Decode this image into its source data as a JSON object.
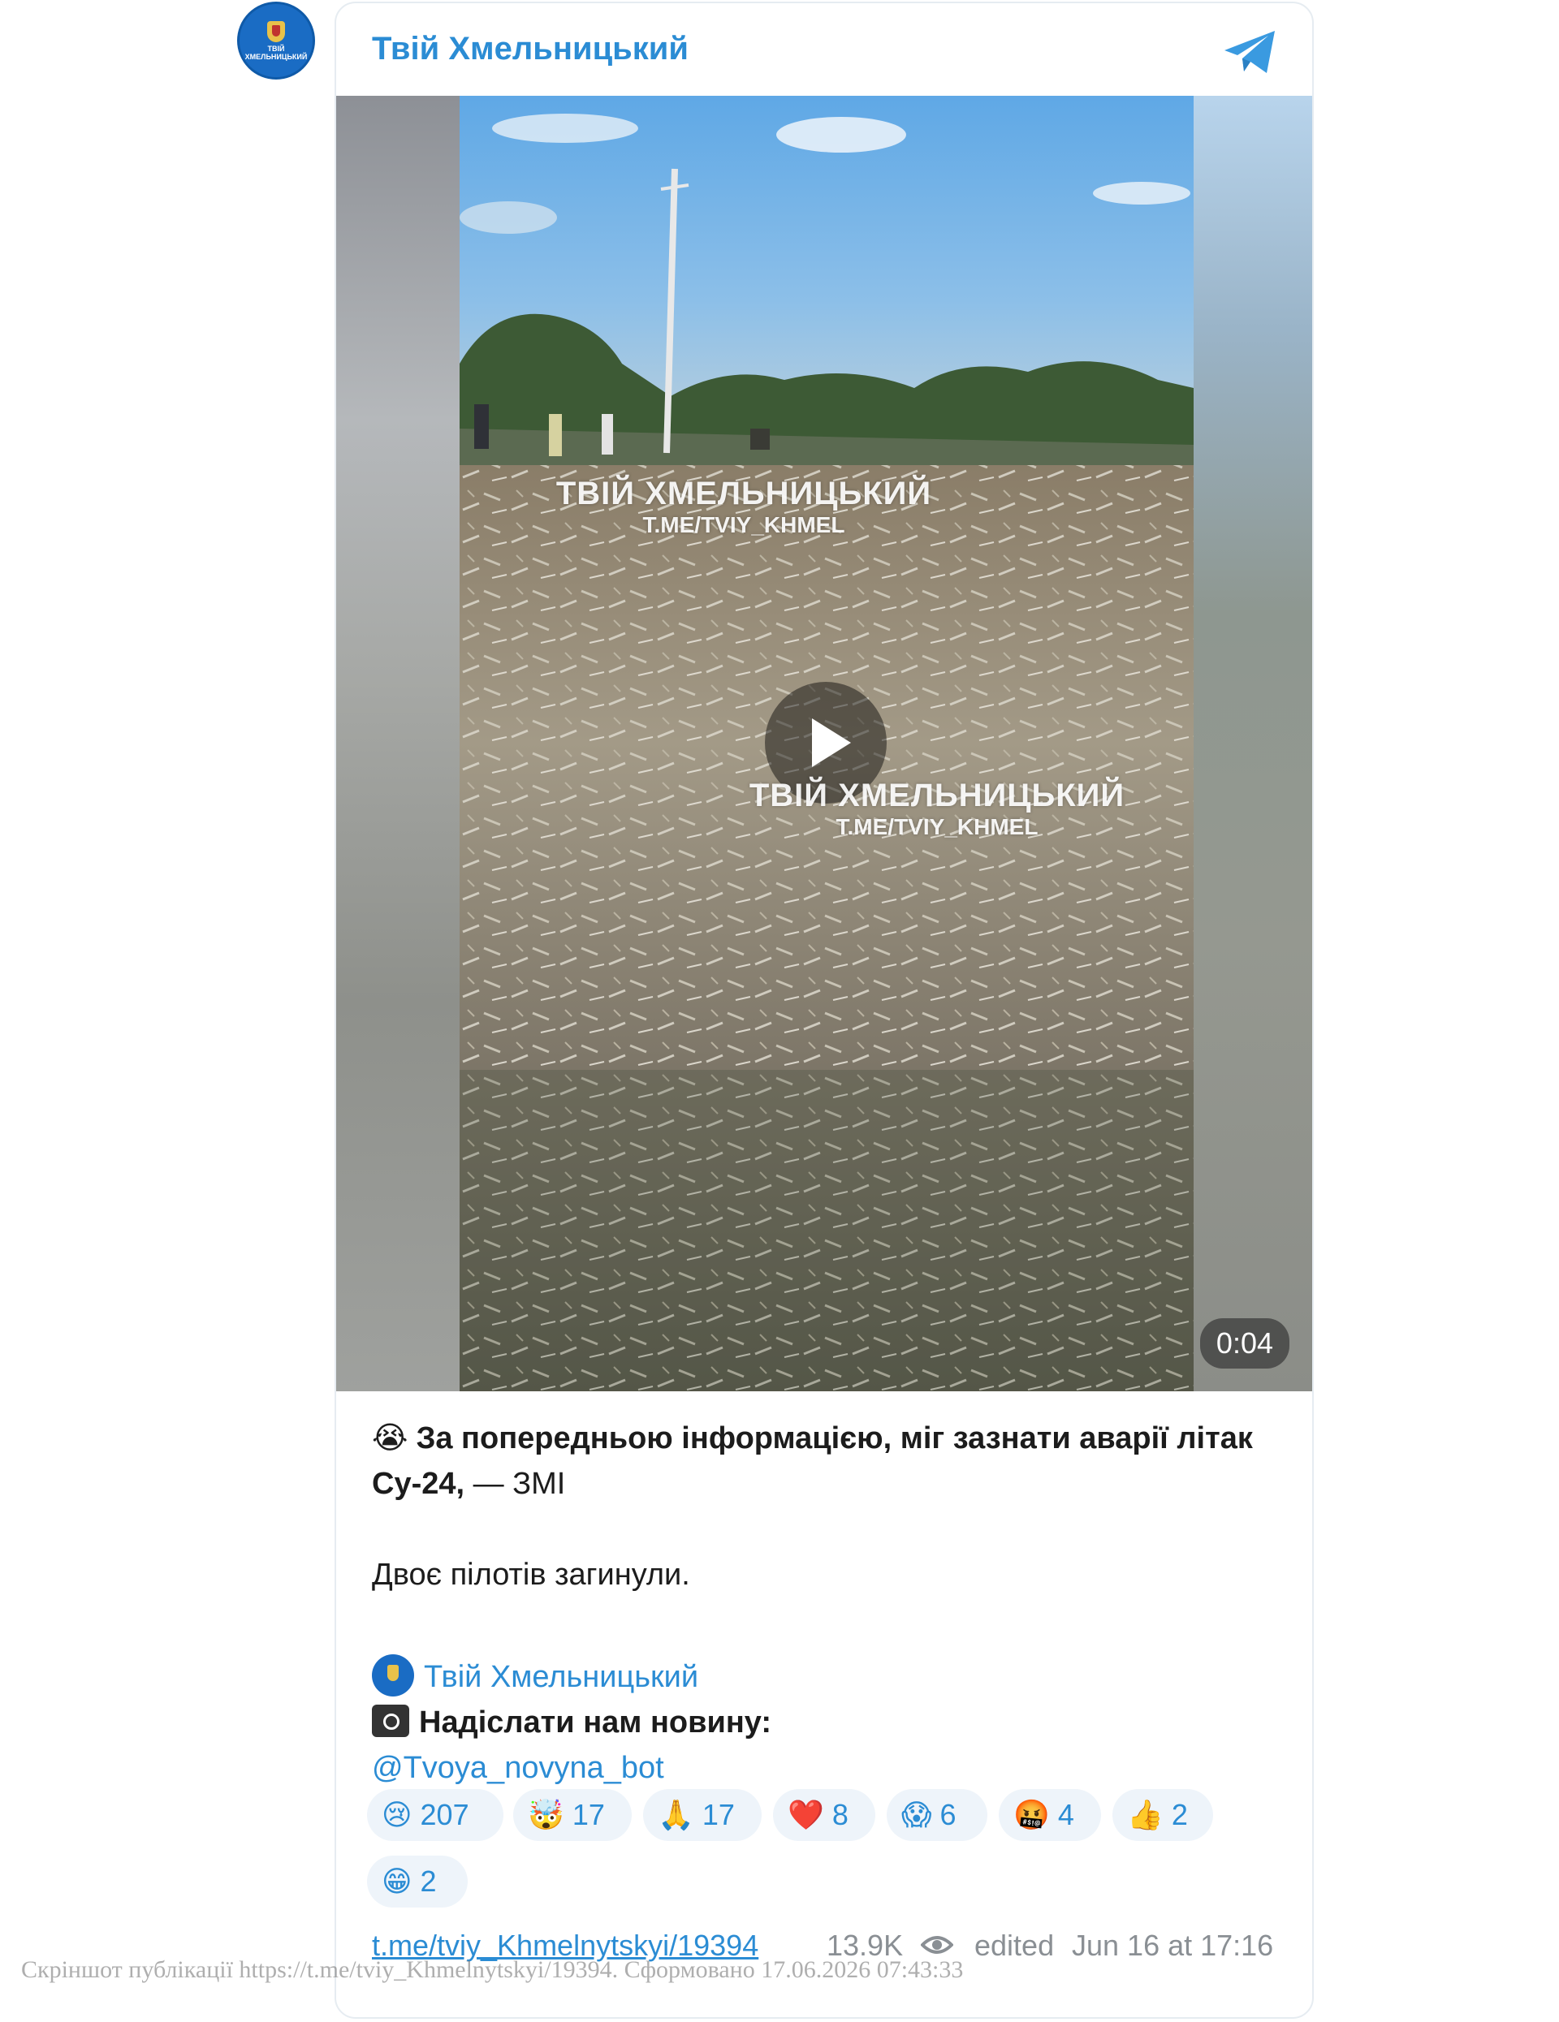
{
  "channel": {
    "name": "Твій Хмельницький",
    "avatar_text": "ТВІЙ ХМЕЛЬНИЦЬКИЙ"
  },
  "colors": {
    "accent": "#2b8cd4",
    "text": "#1c1c1c",
    "muted": "#8a8f94",
    "reaction_bg": "#eef4fa"
  },
  "media": {
    "duration": "0:04",
    "watermark_title": "ТВІЙ ХМЕЛЬНИЦЬКИЙ",
    "watermark_link": "T.ME/TVIY_KHMEL"
  },
  "post": {
    "line1_emoji": "😭",
    "line1_bold": "За попередньою інформацією, міг зазнати аварії літак Су-24,",
    "line1_rest": " — ЗМІ",
    "line2": "Двоє пілотів загинули.",
    "channel_link": "Твій Хмельницький",
    "send_news_label": "Надіслати нам новину:",
    "bot_link": "@Tvoya_novyna_bot"
  },
  "reactions": [
    {
      "emoji": "😢",
      "count": "207"
    },
    {
      "emoji": "🤯",
      "count": "17"
    },
    {
      "emoji": "🙏",
      "count": "17"
    },
    {
      "emoji": "❤️",
      "count": "8"
    },
    {
      "emoji": "😱",
      "count": "6"
    },
    {
      "emoji": "🤬",
      "count": "4"
    },
    {
      "emoji": "👍",
      "count": "2"
    },
    {
      "emoji": "😁",
      "count": "2"
    }
  ],
  "footer": {
    "post_link": "t.me/tviy_Khmelnytskyi/19394",
    "views": "13.9K",
    "edited": "edited",
    "date": "Jun 16 at 17:16"
  },
  "caption": "Скріншот публікації https://t.me/tviy_Khmelnytskyi/19394. Сформовано 17.06.2026 07:43:33"
}
